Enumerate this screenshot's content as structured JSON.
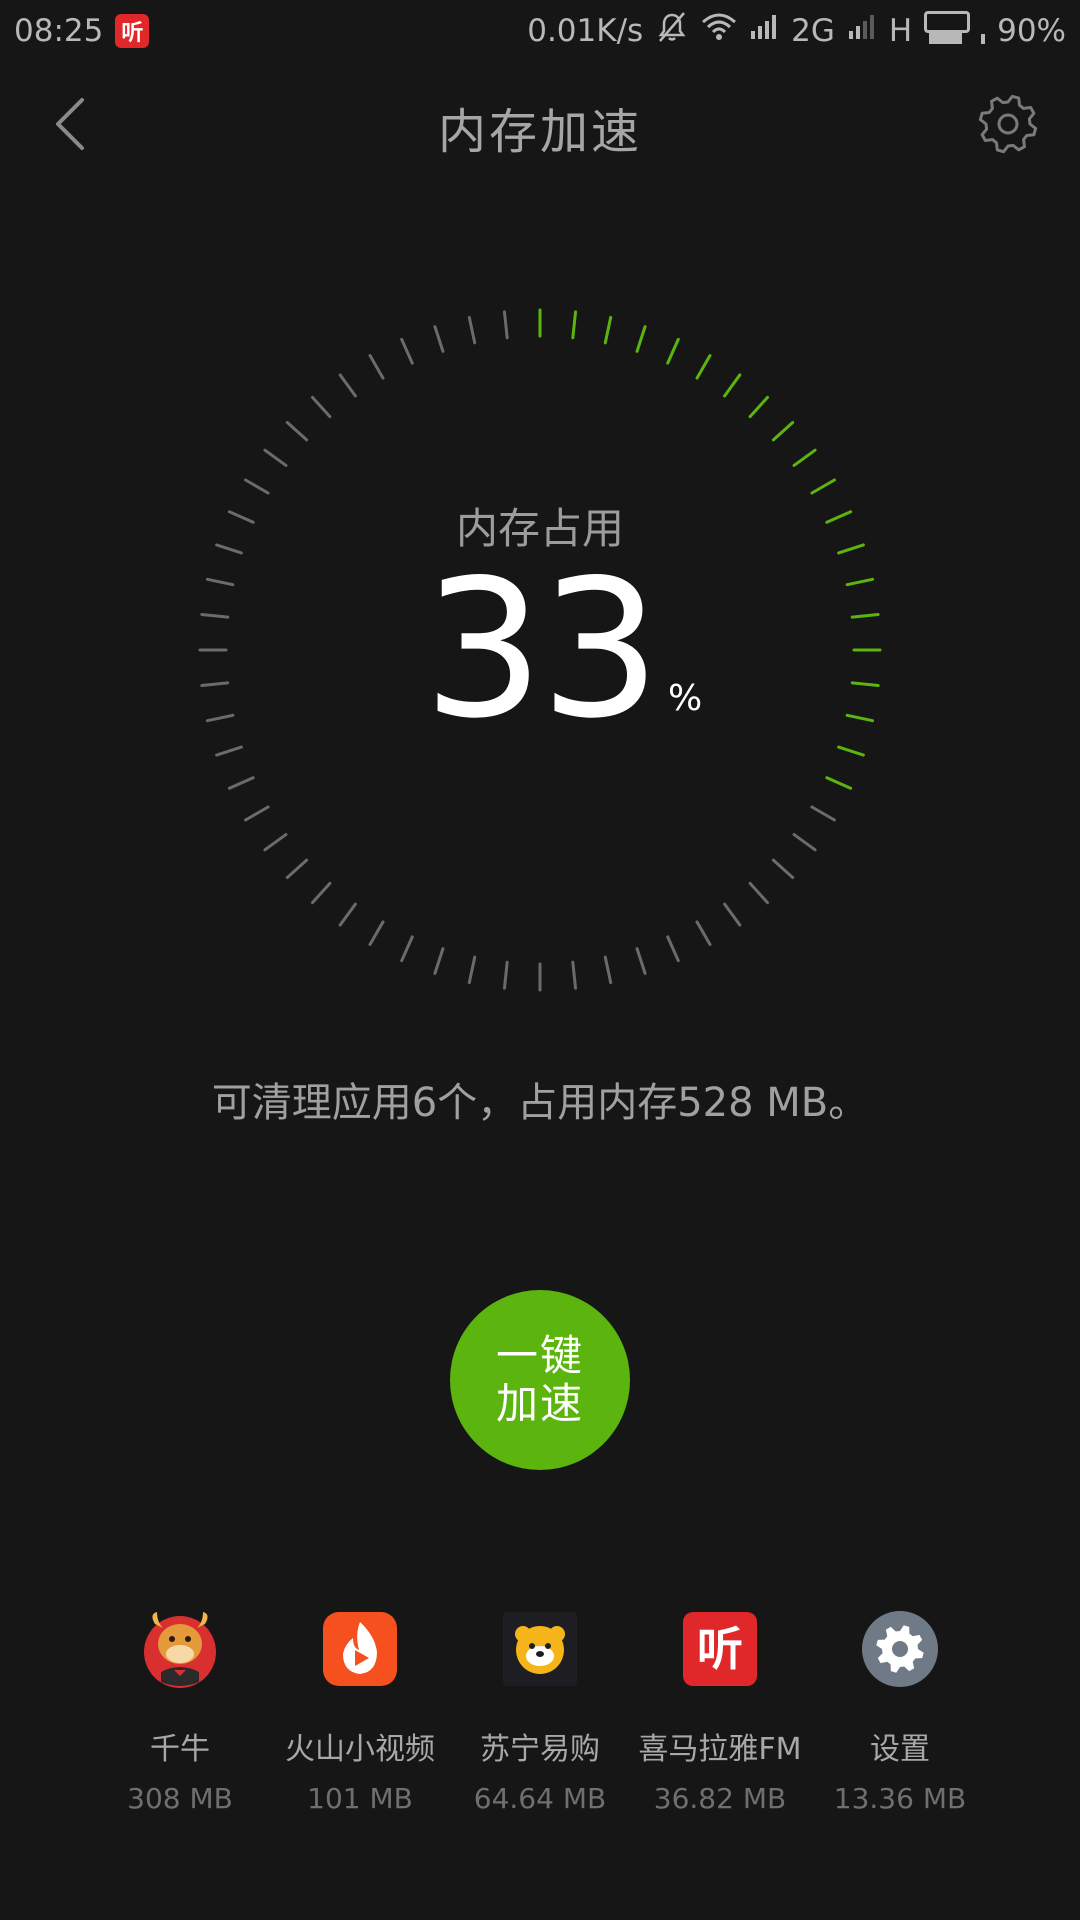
{
  "status_bar": {
    "time": "08:25",
    "notification_app_glyph": "听",
    "network_speed": "0.01K/s",
    "network_2g": "2G",
    "network_h": "H",
    "battery_text": "90%",
    "battery_level": 0.9,
    "icons": [
      "bell-muted-icon",
      "wifi-icon",
      "signal-icon",
      "signal-icon",
      "battery-icon"
    ]
  },
  "header": {
    "title": "内存加速",
    "back_icon": "chevron-left-icon",
    "settings_icon": "gear-icon"
  },
  "gauge": {
    "label": "内存占用",
    "value": "33",
    "unit": "%",
    "fraction": 0.33,
    "total_ticks": 60,
    "active_color": "#5cb40f",
    "inactive_color": "#6b6b6b"
  },
  "summary": "可清理应用6个，占用内存528 MB。",
  "boost_button": {
    "line1": "一键",
    "line2": "加速",
    "color": "#5cb40f"
  },
  "apps": [
    {
      "name": "千牛",
      "size": "308 MB",
      "icon": "qianniu-icon"
    },
    {
      "name": "火山小视频",
      "size": "101 MB",
      "icon": "huoshan-icon"
    },
    {
      "name": "苏宁易购",
      "size": "64.64 MB",
      "icon": "suning-icon"
    },
    {
      "name": "喜马拉雅FM",
      "size": "36.82 MB",
      "icon": "ximalaya-icon",
      "glyph": "听"
    },
    {
      "name": "设置",
      "size": "13.36 MB",
      "icon": "settings-app-icon"
    }
  ]
}
